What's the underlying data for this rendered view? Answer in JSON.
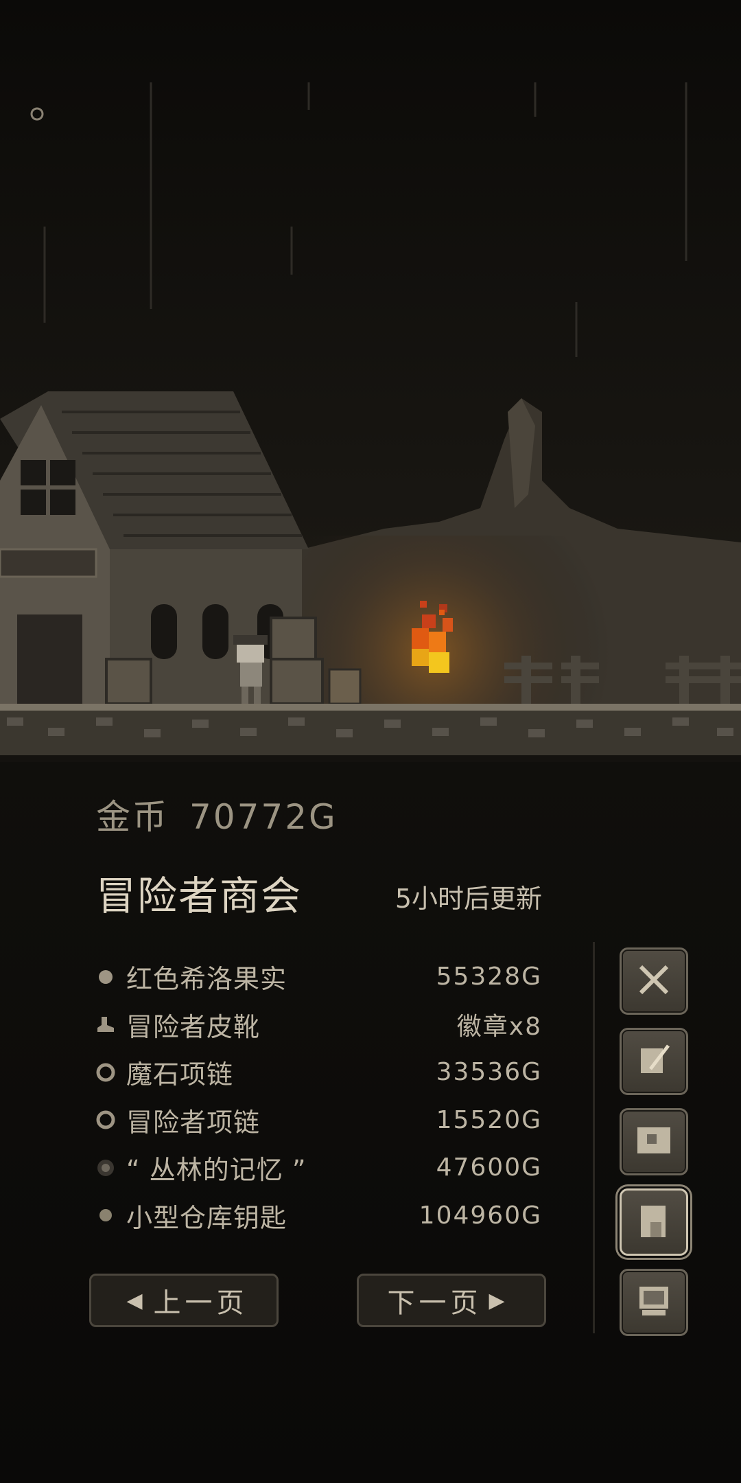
{
  "hud": {
    "settings_icon": "gear-icon"
  },
  "currency": {
    "label": "金币",
    "value": "70772G"
  },
  "shop": {
    "title": "冒险者商会",
    "refresh": "5小时后更新"
  },
  "items": [
    {
      "name": "红色希洛果实",
      "price": "55328G",
      "icon": "fruit-icon"
    },
    {
      "name": "冒险者皮靴",
      "price": "徽章x8",
      "icon": "boot-icon"
    },
    {
      "name": "魔石项链",
      "price": "33536G",
      "icon": "necklace-icon"
    },
    {
      "name": "冒险者项链",
      "price": "15520G",
      "icon": "necklace-icon"
    },
    {
      "name": "“ 丛林的记忆 ”",
      "price": "47600G",
      "icon": "memory-orb-icon"
    },
    {
      "name": "小型仓库钥匙",
      "price": "104960G",
      "icon": "key-icon"
    }
  ],
  "pagination": {
    "prev": "上一页",
    "next": "下一页"
  },
  "side_menu": [
    {
      "icon": "crossed-swords-icon"
    },
    {
      "icon": "quill-scroll-icon"
    },
    {
      "icon": "map-icon"
    },
    {
      "icon": "shop-building-icon",
      "active": true
    },
    {
      "icon": "computer-icon"
    }
  ]
}
